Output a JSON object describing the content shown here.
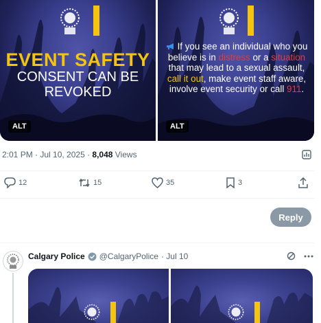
{
  "media": {
    "left": {
      "title": "EVENT SAFETY",
      "subtitle_line1": "CONSENT CAN BE",
      "subtitle_line2": "REVOKED",
      "alt_label": "ALT"
    },
    "right": {
      "msg_1": "If you see an individual who you believe is in ",
      "msg_red_1": "distress",
      "msg_2": " or a ",
      "msg_red_2": "situation",
      "msg_3": " that may lead to a sexual assault, ",
      "msg_gold_1": "call it out",
      "msg_4": ", make event staff aware, involve event security or call ",
      "msg_red_3": "911",
      "msg_5": ".",
      "alt_label": "ALT"
    }
  },
  "meta": {
    "time_date": "2:01 PM · Jul 10, 2025 · ",
    "views_count": "8,048",
    "views_label": " Views"
  },
  "actions": {
    "replies": "12",
    "reposts": "15",
    "likes": "35",
    "bookmarks": "3"
  },
  "reply_button": "Reply",
  "next_post": {
    "name": "Calgary Police",
    "handle": "@CalgaryPolice",
    "time": "· Jul 10"
  },
  "colors": {
    "accent_gold": "#f4c40f",
    "accent_red": "#e23c3c",
    "text_secondary": "#536471"
  },
  "icons": [
    "megaphone-icon",
    "analytics-icon",
    "reply-icon",
    "repost-icon",
    "like-icon",
    "bookmark-icon",
    "share-icon",
    "verified-badge-icon",
    "grok-icon",
    "more-icon"
  ]
}
